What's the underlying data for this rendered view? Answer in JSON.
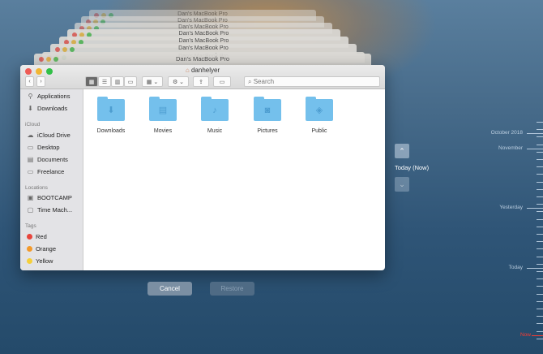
{
  "back_windows": {
    "title": "Dan's MacBook Pro"
  },
  "window": {
    "title": "danhelyer",
    "search_placeholder": "Search"
  },
  "sidebar": {
    "favorites": [
      {
        "label": "Applications"
      },
      {
        "label": "Downloads"
      }
    ],
    "icloud_header": "iCloud",
    "icloud": [
      {
        "label": "iCloud Drive"
      },
      {
        "label": "Desktop"
      },
      {
        "label": "Documents"
      },
      {
        "label": "Freelance"
      }
    ],
    "locations_header": "Locations",
    "locations": [
      {
        "label": "BOOTCAMP"
      },
      {
        "label": "Time Mach..."
      }
    ],
    "tags_header": "Tags",
    "tags": [
      {
        "label": "Red",
        "color": "#e8453c"
      },
      {
        "label": "Orange",
        "color": "#f39a2b"
      },
      {
        "label": "Yellow",
        "color": "#f5cf3a"
      }
    ]
  },
  "folders": [
    {
      "label": "Downloads"
    },
    {
      "label": "Movies"
    },
    {
      "label": "Music"
    },
    {
      "label": "Pictures"
    },
    {
      "label": "Public"
    }
  ],
  "buttons": {
    "cancel": "Cancel",
    "restore": "Restore"
  },
  "timemachine": {
    "current": "Today (Now)"
  },
  "timeline": {
    "labels": [
      "October 2018",
      "November",
      "Yesterday",
      "Today",
      "Now"
    ],
    "now_color": "#ff3b30"
  }
}
